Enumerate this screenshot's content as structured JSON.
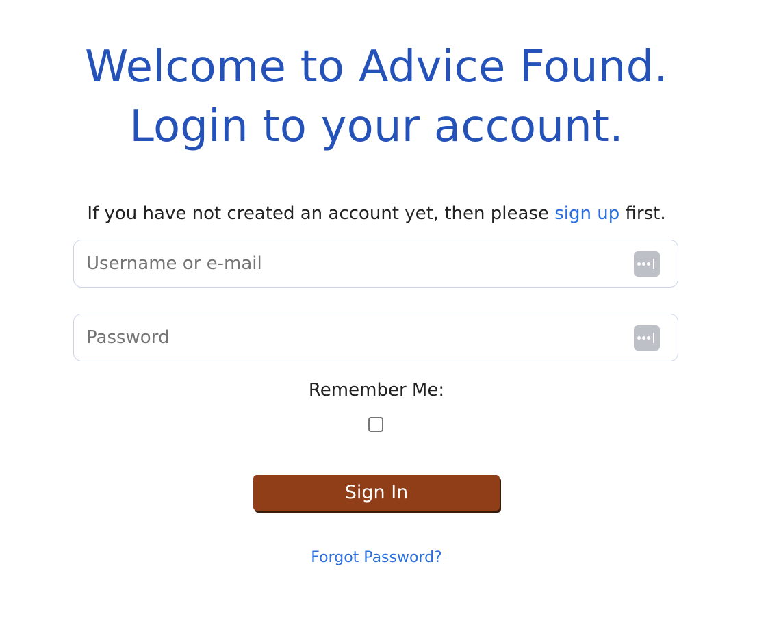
{
  "header": {
    "line1": "Welcome to Advice Found.",
    "line2": "Login to your account."
  },
  "intro": {
    "before": "If you have not created an account yet, then please ",
    "link": "sign up",
    "after": " first."
  },
  "form": {
    "username_placeholder": "Username or e-mail",
    "username_value": "",
    "password_placeholder": "Password",
    "password_value": "",
    "remember_label": "Remember Me:",
    "remember_checked": false,
    "key_icon": "password-manager-key-icon",
    "submit_label": "Sign In",
    "forgot_label": "Forgot Password?"
  },
  "colors": {
    "heading": "#2452b8",
    "link": "#2a6fe0",
    "button": "#8f3e18",
    "button_shadow": "#3b1a08",
    "field_border": "#ccd3e8",
    "key_icon_bg": "#bdc0c7"
  }
}
